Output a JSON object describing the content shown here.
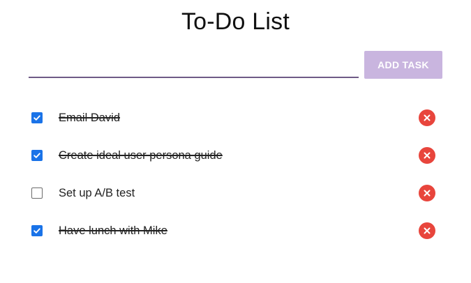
{
  "title": "To-Do List",
  "input": {
    "value": "",
    "placeholder": ""
  },
  "add_button": {
    "label": "ADD TASK"
  },
  "colors": {
    "accent": "#6f5a86",
    "button_bg": "#c9b5df",
    "checkbox_checked": "#1a73e8",
    "delete_bg": "#e8453c"
  },
  "tasks": [
    {
      "label": "Email David",
      "checked": true
    },
    {
      "label": "Create ideal user persona guide",
      "checked": true
    },
    {
      "label": "Set up A/B test",
      "checked": false
    },
    {
      "label": "Have lunch with Mike",
      "checked": true
    }
  ],
  "icons": {
    "checkbox": "check-icon",
    "delete": "close-circle-icon"
  }
}
